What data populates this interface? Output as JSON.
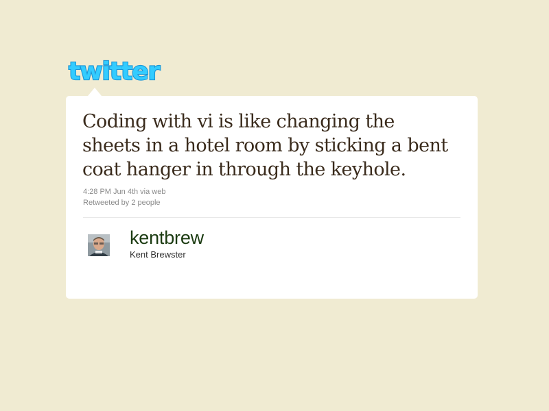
{
  "logo": {
    "text": "twitter",
    "fill_color": "#33ccff",
    "outline_color": "#1b95d6"
  },
  "tweet": {
    "text": "Coding with vi is like changing the sheets in a hotel room by sticking a bent coat hanger in through the keyhole.",
    "timestamp": "4:28 PM Jun 4th",
    "via": "via web",
    "retweeted": "Retweeted by 2 people"
  },
  "author": {
    "username": "kentbrew",
    "full_name": "Kent Brewster"
  },
  "colors": {
    "page_background": "#f0ebd2",
    "card_background": "#ffffff",
    "tweet_text": "#3a2b1c",
    "meta_text": "#8a8a8a",
    "username_text": "#1b3b11"
  }
}
